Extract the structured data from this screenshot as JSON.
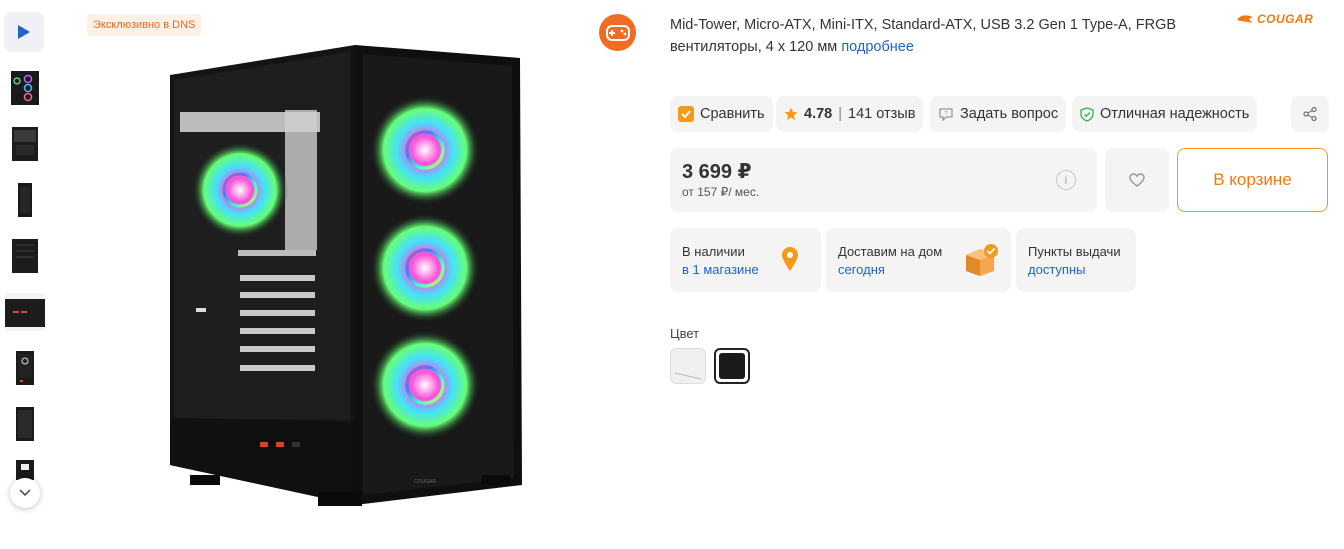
{
  "gallery": {
    "thumbnails": [
      "front-3quarter-view",
      "side-view",
      "front-view",
      "back-3quarter-view",
      "top-view",
      "front-panel-view",
      "side-panel-view",
      "back-view"
    ]
  },
  "badge": {
    "exclusive": "Эксклюзивно в DNS"
  },
  "product": {
    "description": "Mid-Tower, Micro-ATX, Mini-ITX, Standard-ATX, USB 3.2 Gen 1 Type-A, FRGB вентиляторы, 4 x 120 мм",
    "more_link": "подробнее",
    "brand": "COUGAR"
  },
  "actions": {
    "compare": "Сравнить",
    "rating": "4.78",
    "reviews": "141 отзыв",
    "ask": "Задать вопрос",
    "reliability": "Отличная надежность"
  },
  "price": {
    "value": "3 699 ₽",
    "credit": "от 157 ₽/ мес.",
    "cart_label": "В корзине"
  },
  "availability": [
    {
      "title": "В наличии",
      "link": "в 1 магазине"
    },
    {
      "title": "Доставим на дом",
      "link": "сегодня"
    },
    {
      "title": "Пункты выдачи",
      "link": "доступны"
    }
  ],
  "colors": {
    "label": "Цвет",
    "options": [
      "white",
      "black"
    ],
    "selected": "black"
  },
  "theme": {
    "accent": "#f39a1b",
    "link": "#1f64c9",
    "brand_orange": "#f06b23"
  }
}
